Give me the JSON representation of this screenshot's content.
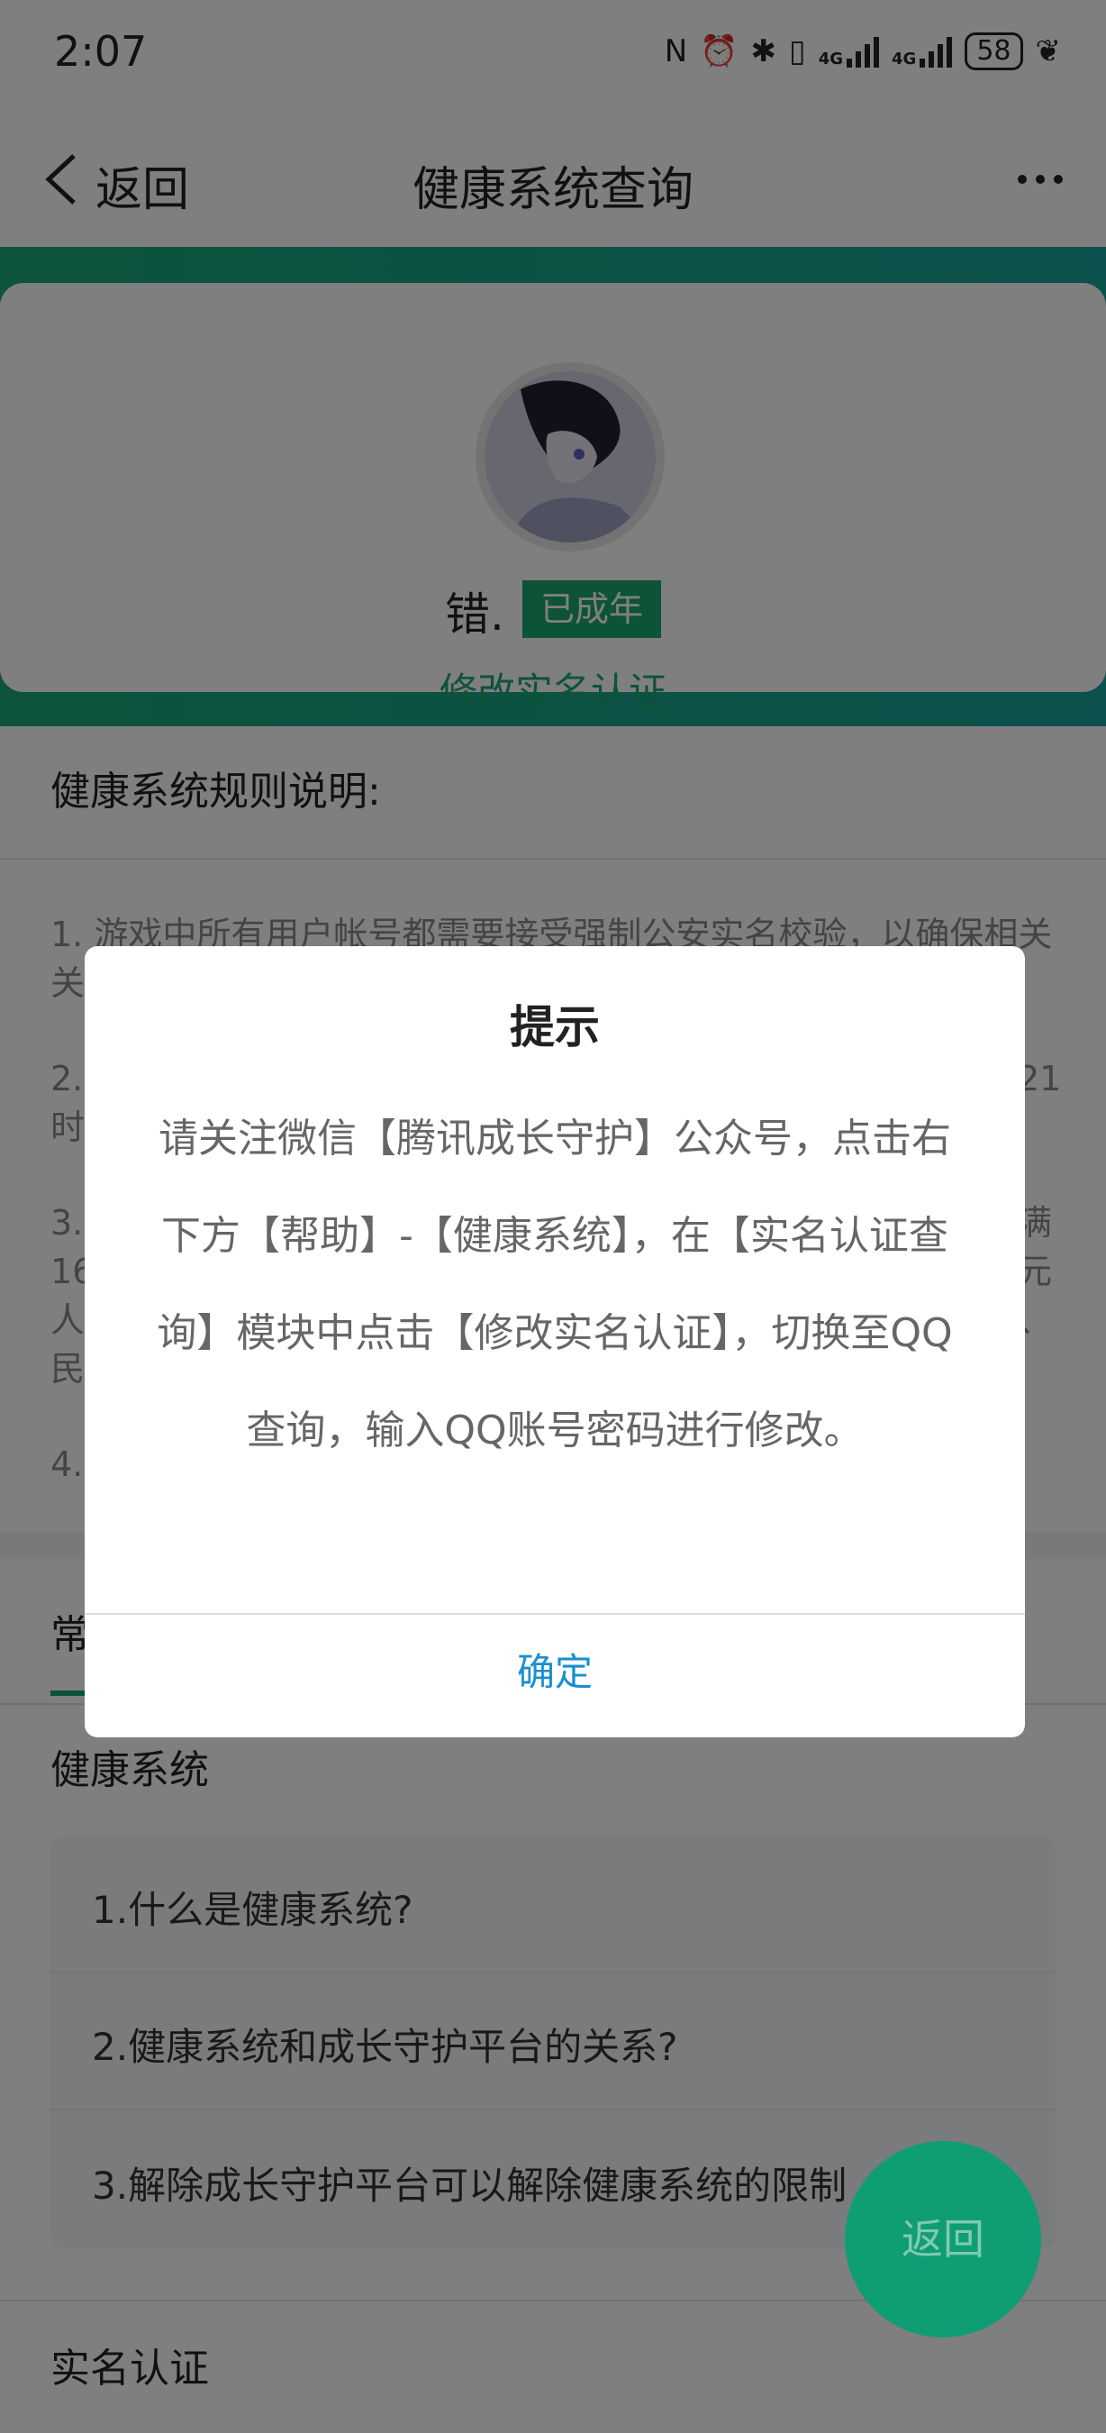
{
  "status_bar": {
    "time": "2:07",
    "battery": "58",
    "signal1": "4G",
    "signal2": "4G"
  },
  "nav": {
    "back_label": "返回",
    "title": "健康系统查询"
  },
  "profile": {
    "nickname": "错.",
    "badge": "已成年",
    "modify_link": "修改实名认证"
  },
  "rules": {
    "heading": "健康系统规则说明:",
    "items": [
      "1. 游戏中所有用户帐号都需要接受强制公安实名校验，以确保相关",
      "2.",
      "3.",
      "4."
    ],
    "line2_end": "21",
    "line2_cont": "时",
    "line3_end": "满",
    "line3_cont_a": "16",
    "line3_cont_b": "人",
    "line3_cont_c": "民",
    "line3_r_b": "元",
    "line3_r_c": "、"
  },
  "tabs": {
    "first_partial": "常"
  },
  "faq": {
    "heading": "健康系统",
    "items": [
      "1.什么是健康系统?",
      "2.健康系统和成长守护平台的关系?",
      "3.解除成长守护平台可以解除健康系统的限制"
    ],
    "next_heading": "实名认证"
  },
  "fab": {
    "label": "返回"
  },
  "dialog": {
    "title": "提示",
    "message": "请关注微信【腾讯成长守护】公众号，点击右下方【帮助】-【健康系统】，在【实名认证查询】模块中点击【修改实名认证】，切换至QQ查询，输入QQ账号密码进行修改。",
    "ok": "确定"
  },
  "colors": {
    "accent": "#1aa66e",
    "link": "#1a8fd0"
  }
}
